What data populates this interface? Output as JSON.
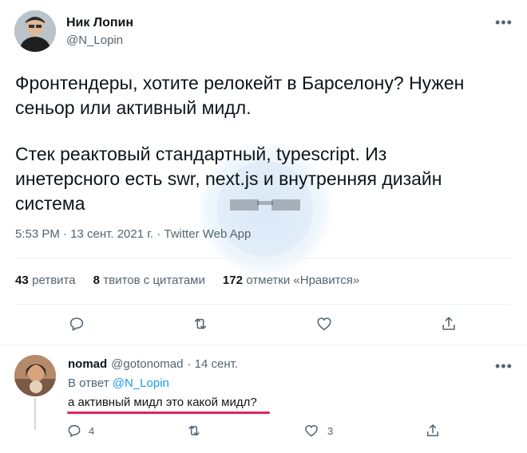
{
  "tweet": {
    "author_name": "Ник Лопин",
    "author_handle": "@N_Lopin",
    "avatar_icon": "user-avatar-icon",
    "text_line1": "Фронтендеры, хотите релокейт в Барселону? Нужен",
    "text_line2": "сеньор или активный мидл.",
    "text_line3": "Стек реактовый стандартный, typescript. Из",
    "text_line4": "инетерсного есть swr, next.js и внутренняя дизайн",
    "text_line5": "система",
    "timestamp": "5:53 PM · 13 сент. 2021 г. · Twitter Web App",
    "stats": {
      "retweets_count": "43",
      "retweets_label": "ретвита",
      "quotes_count": "8",
      "quotes_label": "твитов с цитатами",
      "likes_count": "172",
      "likes_label": "отметки «Нравится»"
    },
    "more_label": "•••"
  },
  "reply": {
    "author_name": "nomad",
    "author_handle": "@gotonomad",
    "time": "· 14 сент.",
    "reply_to_prefix": "В ответ",
    "reply_to_handle": "@N_Lopin",
    "text": "а активный мидл это какой мидл?",
    "reply_count": "4",
    "like_count": "3",
    "more_label": "•••"
  },
  "colors": {
    "accent": "#1d9bf0",
    "underline": "#e0245e",
    "muted": "#536471"
  }
}
